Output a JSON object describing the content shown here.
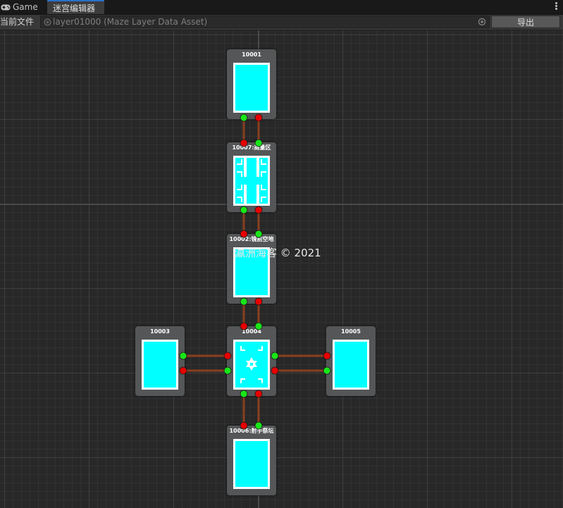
{
  "tabs": [
    {
      "label": "Game",
      "icon": "gamepad-icon",
      "active": false
    },
    {
      "label": "迷宫编辑器",
      "active": true
    }
  ],
  "toolbar": {
    "field_label": "当前文件",
    "file_value": "layer01000 (Maze Layer Data Asset)",
    "export_label": "导出"
  },
  "nodes": [
    {
      "id": "n10001",
      "title": "10001",
      "room_pattern": "plain"
    },
    {
      "id": "n10007",
      "title": "10007:商量区",
      "room_pattern": "cross-rooms"
    },
    {
      "id": "n10002",
      "title": "10002:镜前空地",
      "room_pattern": "plain"
    },
    {
      "id": "n10003",
      "title": "10003",
      "room_pattern": "plain"
    },
    {
      "id": "n10004",
      "title": "10004",
      "room_pattern": "hub"
    },
    {
      "id": "n10005",
      "title": "10005",
      "room_pattern": "plain"
    },
    {
      "id": "n10006",
      "title": "10006:射手祭坛",
      "room_pattern": "plain"
    }
  ],
  "connections": [
    {
      "from": "10001",
      "to": "10007"
    },
    {
      "from": "10007",
      "to": "10002"
    },
    {
      "from": "10002",
      "to": "10004"
    },
    {
      "from": "10003",
      "to": "10004"
    },
    {
      "from": "10004",
      "to": "10005"
    },
    {
      "from": "10004",
      "to": "10006"
    }
  ],
  "colors": {
    "room_fill": "#00ffff",
    "port_out": "#e80000",
    "port_in": "#19e619",
    "wire": "#8a3f1f",
    "node_bg": "#545657"
  },
  "watermark": "瀛洲海客 © 2021"
}
